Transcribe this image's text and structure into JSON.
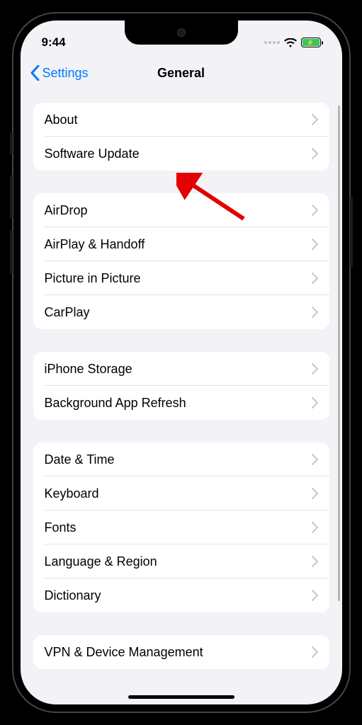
{
  "status": {
    "time": "9:44"
  },
  "nav": {
    "back_label": "Settings",
    "title": "General"
  },
  "groups": [
    {
      "rows": [
        {
          "name": "about",
          "label": "About"
        },
        {
          "name": "software-update",
          "label": "Software Update"
        }
      ]
    },
    {
      "rows": [
        {
          "name": "airdrop",
          "label": "AirDrop"
        },
        {
          "name": "airplay-handoff",
          "label": "AirPlay & Handoff"
        },
        {
          "name": "picture-in-picture",
          "label": "Picture in Picture"
        },
        {
          "name": "carplay",
          "label": "CarPlay"
        }
      ]
    },
    {
      "rows": [
        {
          "name": "iphone-storage",
          "label": "iPhone Storage"
        },
        {
          "name": "background-app-refresh",
          "label": "Background App Refresh"
        }
      ]
    },
    {
      "rows": [
        {
          "name": "date-time",
          "label": "Date & Time"
        },
        {
          "name": "keyboard",
          "label": "Keyboard"
        },
        {
          "name": "fonts",
          "label": "Fonts"
        },
        {
          "name": "language-region",
          "label": "Language & Region"
        },
        {
          "name": "dictionary",
          "label": "Dictionary"
        }
      ]
    },
    {
      "rows": [
        {
          "name": "vpn-device-management",
          "label": "VPN & Device Management"
        }
      ]
    }
  ]
}
